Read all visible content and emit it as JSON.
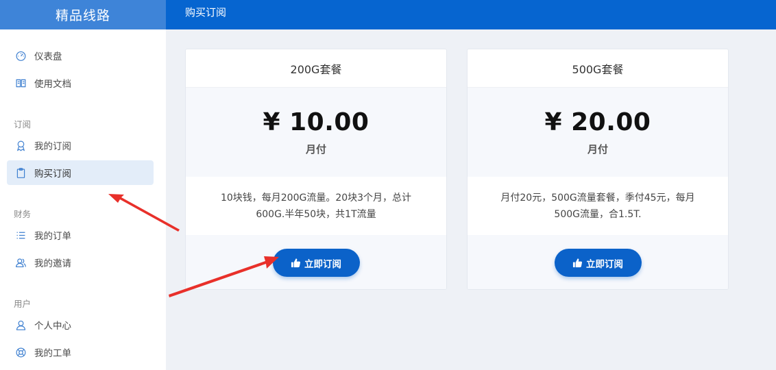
{
  "header": {
    "brand": "精品线路",
    "page_title": "购买订阅"
  },
  "sidebar": {
    "items_top": [
      {
        "label": "仪表盘",
        "icon": "dashboard-icon"
      },
      {
        "label": "使用文档",
        "icon": "book-icon"
      }
    ],
    "sections": [
      {
        "label": "订阅",
        "items": [
          {
            "label": "我的订阅",
            "icon": "badge-icon"
          },
          {
            "label": "购买订阅",
            "icon": "clipboard-icon",
            "active": true
          }
        ]
      },
      {
        "label": "财务",
        "items": [
          {
            "label": "我的订单",
            "icon": "list-icon"
          },
          {
            "label": "我的邀请",
            "icon": "users-icon"
          }
        ]
      },
      {
        "label": "用户",
        "items": [
          {
            "label": "个人中心",
            "icon": "user-icon"
          },
          {
            "label": "我的工单",
            "icon": "lifebuoy-icon"
          }
        ]
      }
    ]
  },
  "plans": [
    {
      "name": "200G套餐",
      "price": "¥ 10.00",
      "period": "月付",
      "description": "10块钱，每月200G流量。20块3个月，总计600G.半年50块，共1T流量",
      "button": "立即订阅"
    },
    {
      "name": "500G套餐",
      "price": "¥ 20.00",
      "period": "月付",
      "description": "月付20元，500G流量套餐，季付45元，每月500G流量，合1.5T.",
      "button": "立即订阅"
    }
  ],
  "colors": {
    "primary": "#0665d0",
    "brand_bg": "#3e84d8",
    "annotation_arrow": "#e8302a"
  }
}
